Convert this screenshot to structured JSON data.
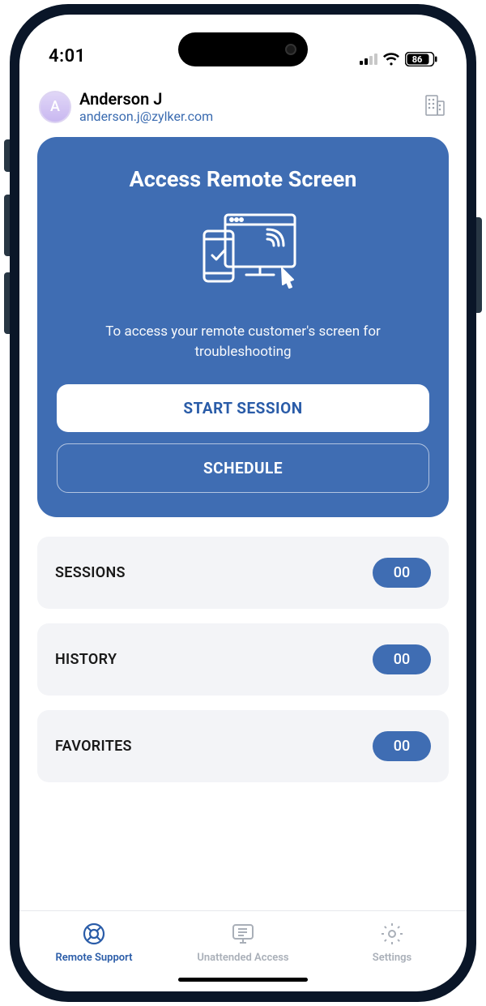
{
  "status": {
    "time": "4:01",
    "battery": "86"
  },
  "user": {
    "initial": "A",
    "name": "Anderson J",
    "email": "anderson.j@zylker.com"
  },
  "hero": {
    "title": "Access Remote Screen",
    "description": "To access your remote customer's screen for troubleshooting",
    "start_label": "START SESSION",
    "schedule_label": "SCHEDULE"
  },
  "list": {
    "items": [
      {
        "label": "SESSIONS",
        "count": "00"
      },
      {
        "label": "HISTORY",
        "count": "00"
      },
      {
        "label": "FAVORITES",
        "count": "00"
      }
    ]
  },
  "tabs": {
    "items": [
      {
        "label": "Remote Support"
      },
      {
        "label": "Unattended Access"
      },
      {
        "label": "Settings"
      }
    ]
  }
}
